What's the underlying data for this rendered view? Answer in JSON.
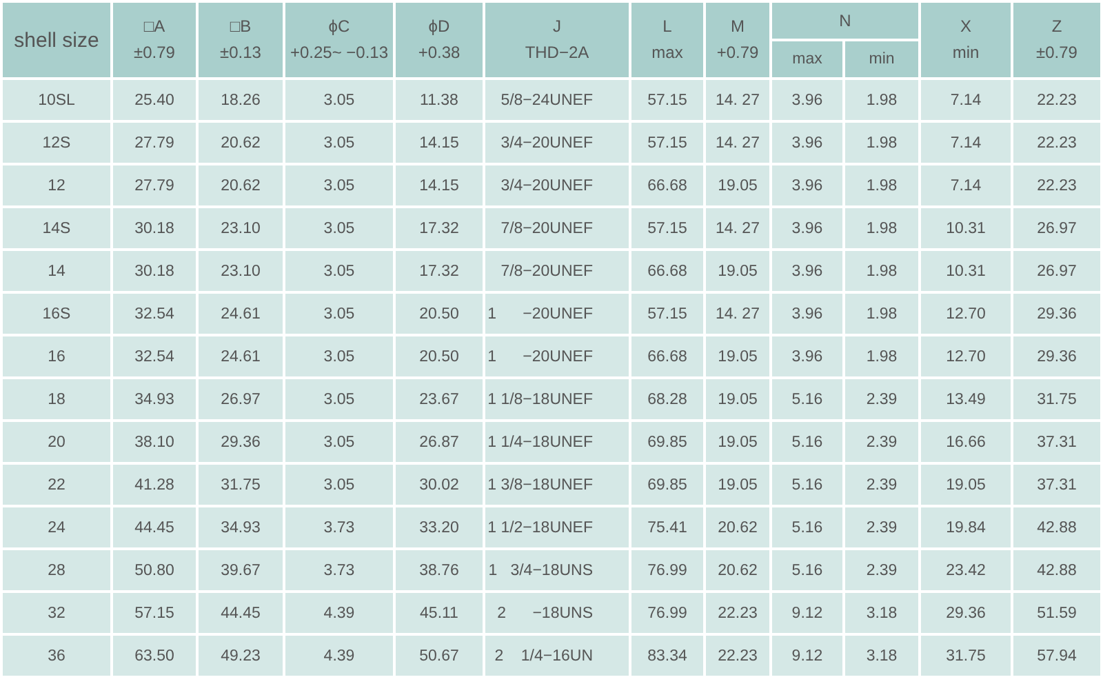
{
  "table": {
    "columns": [
      {
        "label": "shell size"
      },
      {
        "label": "□A",
        "sub": "±0.79"
      },
      {
        "label": "□B",
        "sub": "±0.13"
      },
      {
        "label": "ϕC",
        "sub": "+0.25~ −0.13"
      },
      {
        "label": "ϕD",
        "sub": "+0.38"
      },
      {
        "label": "J",
        "sub": "THD−2A"
      },
      {
        "label": "L",
        "sub": "max"
      },
      {
        "label": "M",
        "sub": "+0.79"
      },
      {
        "label": "N",
        "colspan": 2,
        "children": [
          "max",
          "min"
        ]
      },
      {
        "label": "X",
        "sub": "min"
      },
      {
        "label": "Z",
        "sub": "±0.79"
      }
    ],
    "rows": [
      [
        "10SL",
        "25.40",
        "18.26",
        "3.05",
        "11.38",
        "5/8−24UNEF",
        "57.15",
        "14. 27",
        "3.96",
        "1.98",
        "7.14",
        "22.23"
      ],
      [
        "12S",
        "27.79",
        "20.62",
        "3.05",
        "14.15",
        "3/4−20UNEF",
        "57.15",
        "14. 27",
        "3.96",
        "1.98",
        "7.14",
        "22.23"
      ],
      [
        "12",
        "27.79",
        "20.62",
        "3.05",
        "14.15",
        "3/4−20UNEF",
        "66.68",
        "19.05",
        "3.96",
        "1.98",
        "7.14",
        "22.23"
      ],
      [
        "14S",
        "30.18",
        "23.10",
        "3.05",
        "17.32",
        "7/8−20UNEF",
        "57.15",
        "14. 27",
        "3.96",
        "1.98",
        "10.31",
        "26.97"
      ],
      [
        "14",
        "30.18",
        "23.10",
        "3.05",
        "17.32",
        "7/8−20UNEF",
        "66.68",
        "19.05",
        "3.96",
        "1.98",
        "10.31",
        "26.97"
      ],
      [
        "16S",
        "32.54",
        "24.61",
        "3.05",
        "20.50",
        "1      −20UNEF",
        "57.15",
        "14. 27",
        "3.96",
        "1.98",
        "12.70",
        "29.36"
      ],
      [
        "16",
        "32.54",
        "24.61",
        "3.05",
        "20.50",
        "1      −20UNEF",
        "66.68",
        "19.05",
        "3.96",
        "1.98",
        "12.70",
        "29.36"
      ],
      [
        "18",
        "34.93",
        "26.97",
        "3.05",
        "23.67",
        "1 1/8−18UNEF",
        "68.28",
        "19.05",
        "5.16",
        "2.39",
        "13.49",
        "31.75"
      ],
      [
        "20",
        "38.10",
        "29.36",
        "3.05",
        "26.87",
        "1 1/4−18UNEF",
        "69.85",
        "19.05",
        "5.16",
        "2.39",
        "16.66",
        "37.31"
      ],
      [
        "22",
        "41.28",
        "31.75",
        "3.05",
        "30.02",
        "1 3/8−18UNEF",
        "69.85",
        "19.05",
        "5.16",
        "2.39",
        "19.05",
        "37.31"
      ],
      [
        "24",
        "44.45",
        "34.93",
        "3.73",
        "33.20",
        "1 1/2−18UNEF",
        "75.41",
        "20.62",
        "5.16",
        "2.39",
        "19.84",
        "42.88"
      ],
      [
        "28",
        "50.80",
        "39.67",
        "3.73",
        "38.76",
        "1   3/4−18UNS",
        "76.99",
        "20.62",
        "5.16",
        "2.39",
        "23.42",
        "42.88"
      ],
      [
        "32",
        "57.15",
        "44.45",
        "4.39",
        "45.11",
        "2      −18UNS",
        "76.99",
        "22.23",
        "9.12",
        "3.18",
        "29.36",
        "51.59"
      ],
      [
        "36",
        "63.50",
        "49.23",
        "4.39",
        "50.67",
        "2    1/4−16UN",
        "83.34",
        "22.23",
        "9.12",
        "3.18",
        "31.75",
        "57.94"
      ]
    ]
  }
}
